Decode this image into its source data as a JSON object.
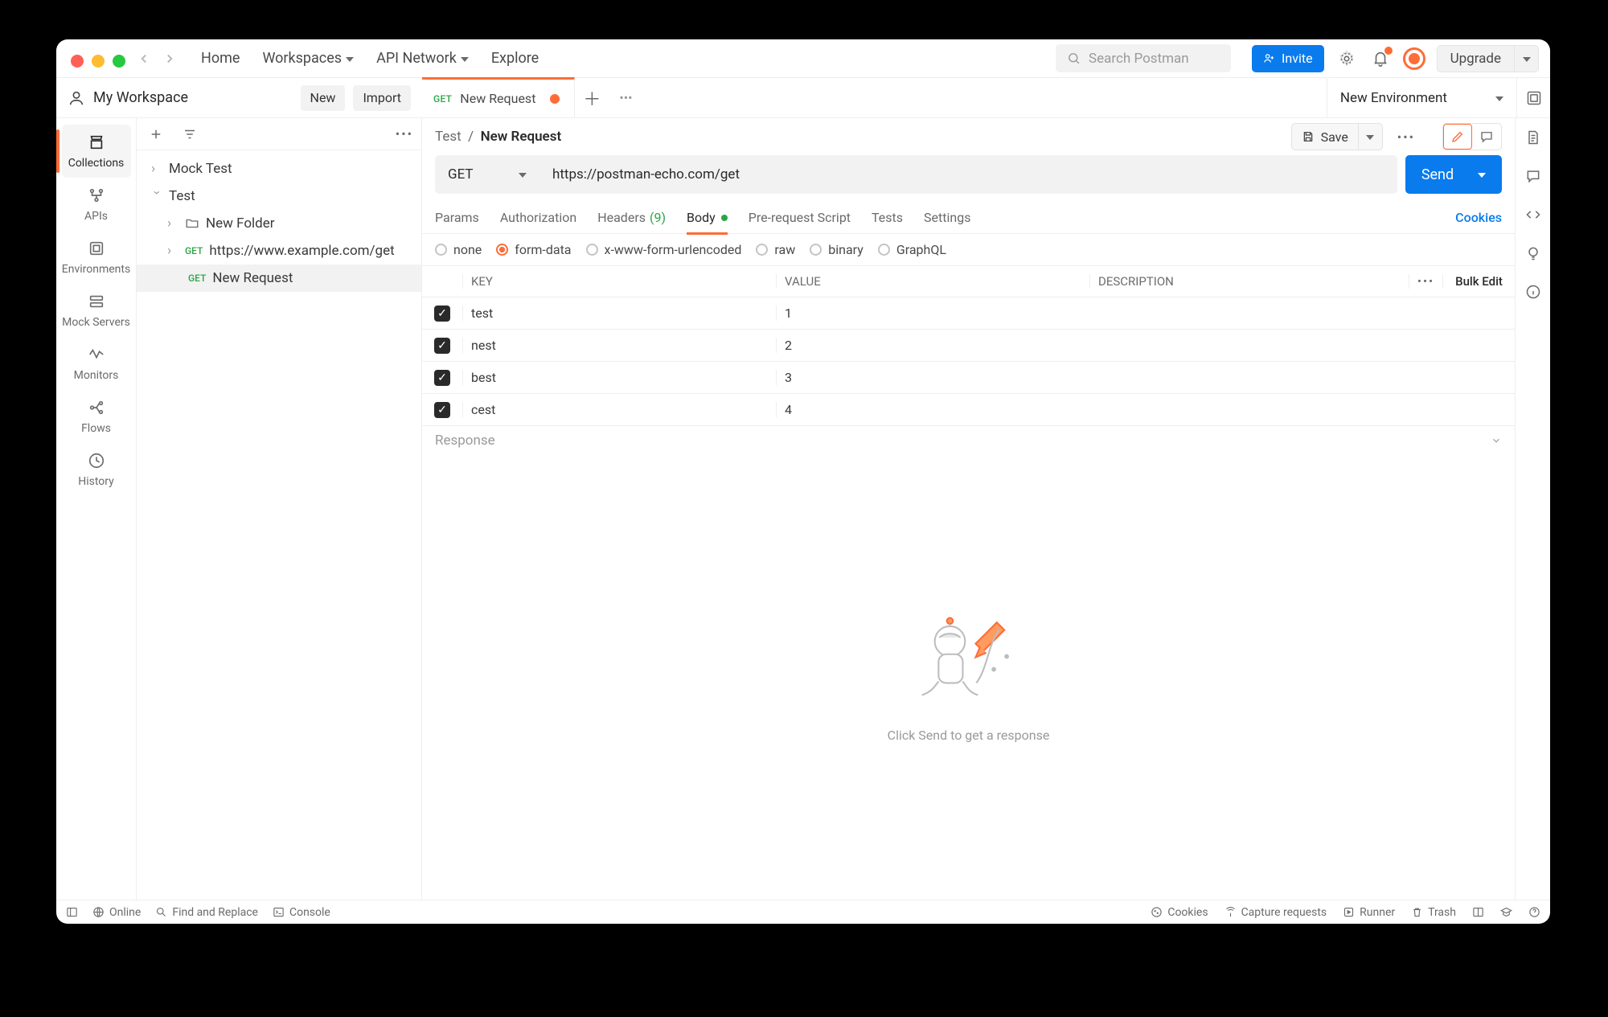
{
  "topbar": {
    "home": "Home",
    "workspaces": "Workspaces",
    "api_network": "API Network",
    "explore": "Explore",
    "search_placeholder": "Search Postman",
    "invite": "Invite",
    "upgrade": "Upgrade"
  },
  "workspace": {
    "name": "My Workspace",
    "new": "New",
    "import": "Import"
  },
  "tabs": [
    {
      "method": "GET",
      "title": "New Request",
      "dirty": true
    }
  ],
  "env_selector": "New Environment",
  "rail": [
    "Collections",
    "APIs",
    "Environments",
    "Mock Servers",
    "Monitors",
    "Flows",
    "History"
  ],
  "tree": {
    "root": [
      {
        "type": "folder",
        "label": "Mock Test"
      },
      {
        "type": "folder",
        "label": "Test",
        "open": true,
        "children": [
          {
            "type": "folder",
            "label": "New Folder"
          },
          {
            "type": "request",
            "method": "GET",
            "label": "https://www.example.com/get"
          },
          {
            "type": "request",
            "method": "GET",
            "label": "New Request",
            "selected": true
          }
        ]
      }
    ]
  },
  "breadcrumb": {
    "path": "Test",
    "name": "New Request"
  },
  "save": "Save",
  "request": {
    "method": "GET",
    "url": "https://postman-echo.com/get",
    "send": "Send"
  },
  "subtabs": {
    "params": "Params",
    "auth": "Authorization",
    "headers": "Headers",
    "headers_count": "(9)",
    "body": "Body",
    "prereq": "Pre-request Script",
    "tests": "Tests",
    "settings": "Settings",
    "cookies": "Cookies"
  },
  "body_types": [
    "none",
    "form-data",
    "x-www-form-urlencoded",
    "raw",
    "binary",
    "GraphQL"
  ],
  "kv_header": {
    "key": "KEY",
    "value": "VALUE",
    "desc": "DESCRIPTION",
    "bulk": "Bulk Edit"
  },
  "kv_rows": [
    {
      "checked": true,
      "key": "test",
      "value": "1",
      "desc": ""
    },
    {
      "checked": true,
      "key": "nest",
      "value": "2",
      "desc": ""
    },
    {
      "checked": true,
      "key": "best",
      "value": "3",
      "desc": ""
    },
    {
      "checked": true,
      "key": "cest",
      "value": "4",
      "desc": ""
    }
  ],
  "response": {
    "label": "Response",
    "empty": "Click Send to get a response"
  },
  "statusbar": {
    "online": "Online",
    "find": "Find and Replace",
    "console": "Console",
    "cookies": "Cookies",
    "capture": "Capture requests",
    "runner": "Runner",
    "trash": "Trash"
  }
}
